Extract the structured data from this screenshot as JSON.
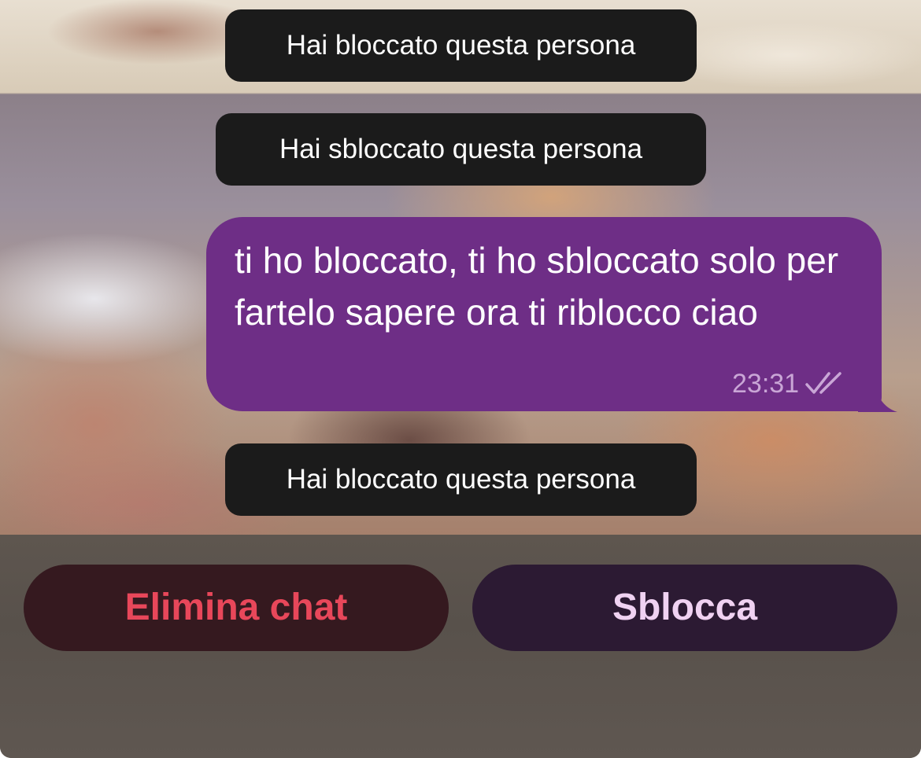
{
  "chat": {
    "system_messages": [
      "Hai bloccato questa persona",
      "Hai sbloccato questa persona",
      "Hai bloccato questa persona"
    ],
    "message": {
      "text": "ti ho bloccato, ti ho sbloccato solo per fartelo sapere ora ti riblocco ciao",
      "time": "23:31",
      "status_icon": "double-check-icon"
    }
  },
  "actions": {
    "delete_label": "Elimina chat",
    "unblock_label": "Sblocca"
  },
  "colors": {
    "bubble": "#6e2e86",
    "service_pill": "#1b1b1b",
    "delete_text": "#e8475a",
    "unblock_text": "#f0d2f2"
  }
}
